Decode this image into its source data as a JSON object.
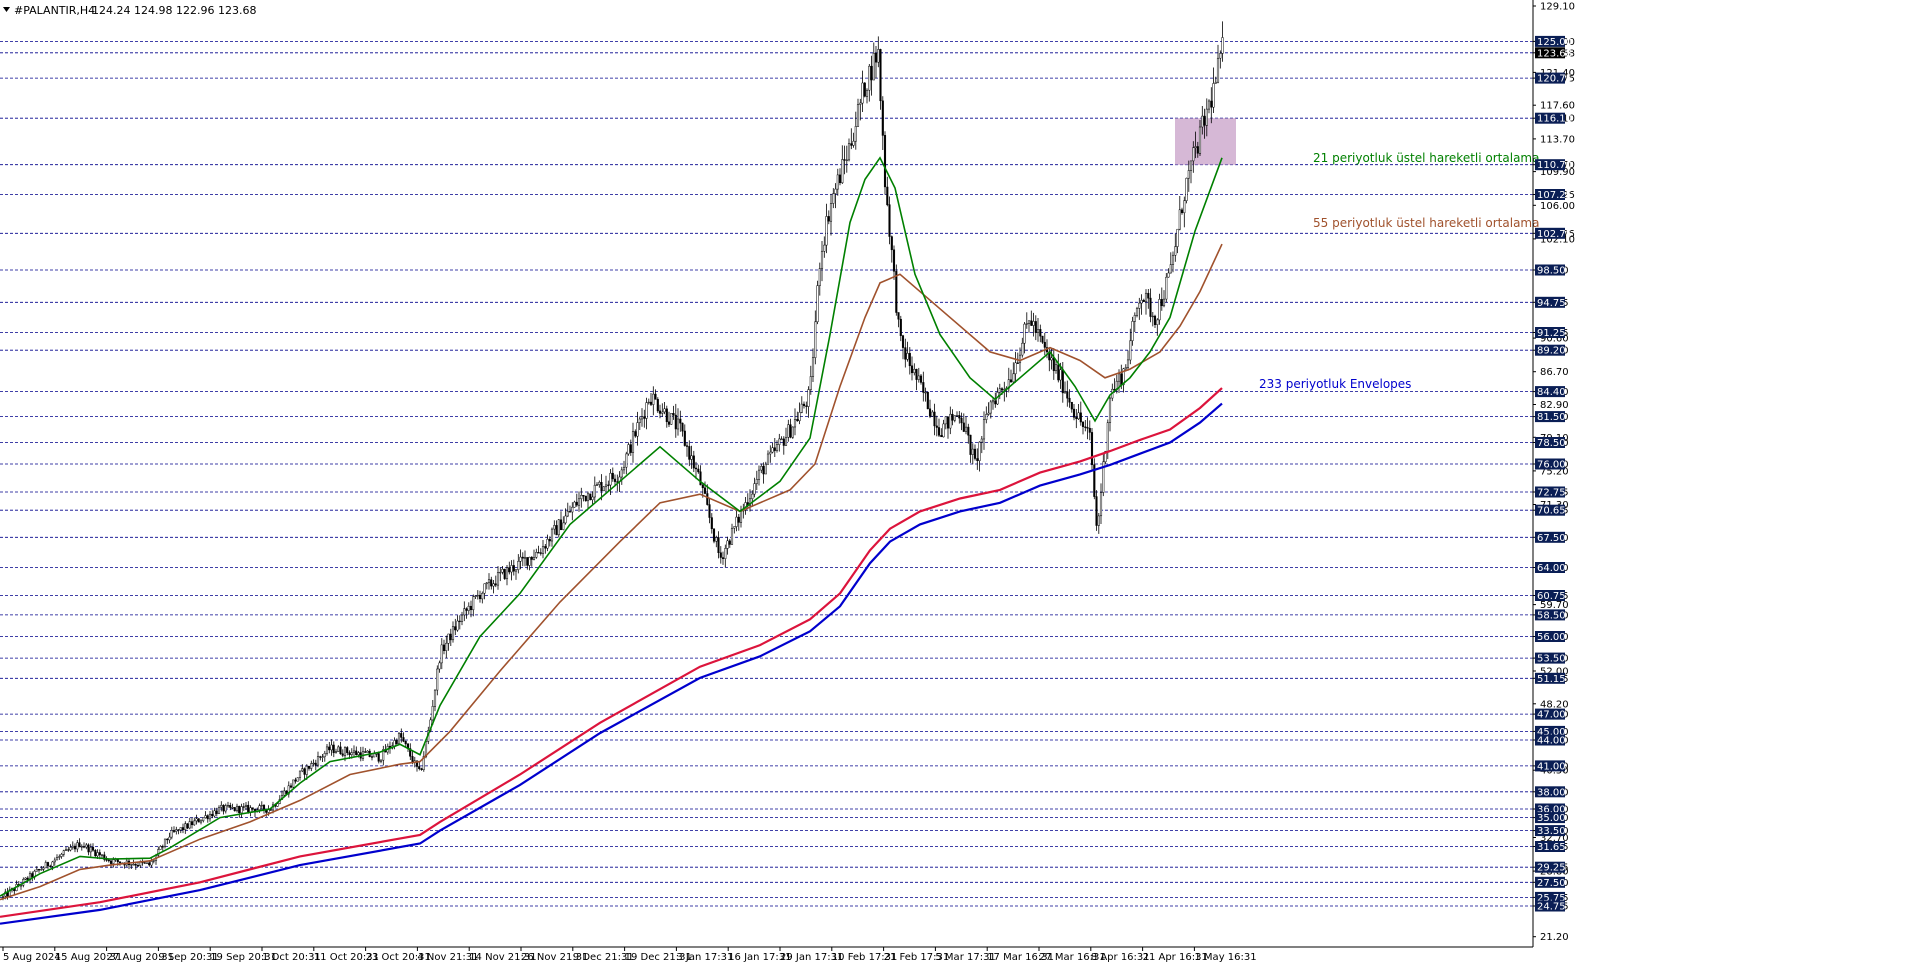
{
  "header": {
    "symbol": "#PALANTIR,H4",
    "ohlc": "124.24 124.98 122.96 123.68"
  },
  "chart_data": {
    "type": "candlestick",
    "y_range": [
      20.0,
      129.8
    ],
    "y_ticks": [
      "129.10",
      "125.00",
      "123.68",
      "121.40",
      "120.75",
      "117.60",
      "116.10",
      "113.70",
      "110.70",
      "109.90",
      "107.25",
      "106.00",
      "102.75",
      "102.10",
      "98.50",
      "94.75",
      "91.25",
      "90.60",
      "89.20",
      "86.70",
      "84.40",
      "82.90",
      "81.50",
      "79.10",
      "78.50",
      "76.00",
      "75.20",
      "72.75",
      "71.30",
      "70.65",
      "67.50",
      "64.00",
      "60.75",
      "59.70",
      "58.50",
      "56.00",
      "53.50",
      "52.00",
      "51.15",
      "48.20",
      "47.00",
      "45.00",
      "44.00",
      "41.00",
      "40.50",
      "38.00",
      "36.00",
      "35.00",
      "33.50",
      "32.70",
      "31.65",
      "29.25",
      "28.80",
      "27.50",
      "25.75",
      "24.75",
      "21.20"
    ],
    "levels": [
      "125.00",
      "123.68",
      "120.75",
      "116.10",
      "110.70",
      "107.25",
      "102.75",
      "98.50",
      "94.75",
      "91.25",
      "89.20",
      "84.40",
      "81.50",
      "78.50",
      "76.00",
      "72.75",
      "70.65",
      "67.50",
      "64.00",
      "60.75",
      "58.50",
      "56.00",
      "53.50",
      "51.15",
      "47.00",
      "45.00",
      "44.00",
      "41.00",
      "38.00",
      "36.00",
      "35.00",
      "33.50",
      "31.65",
      "29.25",
      "27.50",
      "25.75",
      "24.75"
    ],
    "current_price": "123.68",
    "x_labels": [
      "5 Aug 2024",
      "15 Aug 20:31",
      "27 Aug 20:31",
      "9 Sep 20:31",
      "19 Sep 20:31",
      "1 Oct 20:31",
      "11 Oct 20:31",
      "23 Oct 20:31",
      "4 Nov 21:31",
      "14 Nov 21:31",
      "26 Nov 21:31",
      "9 Dec 21:31",
      "19 Dec 21:31",
      "3 Jan 17:31",
      "16 Jan 17:31",
      "29 Jan 17:31",
      "10 Feb 17:31",
      "21 Feb 17:31",
      "5 Mar 17:31",
      "17 Mar 16:31",
      "27 Mar 16:31",
      "8 Apr 16:31",
      "21 Apr 16:31",
      "1 May 16:31"
    ],
    "price_path": [
      [
        0,
        25.5
      ],
      [
        40,
        29
      ],
      [
        80,
        32
      ],
      [
        110,
        30
      ],
      [
        150,
        29.5
      ],
      [
        170,
        33
      ],
      [
        220,
        36
      ],
      [
        270,
        36
      ],
      [
        300,
        40
      ],
      [
        330,
        43
      ],
      [
        380,
        42
      ],
      [
        400,
        44.5
      ],
      [
        420,
        40
      ],
      [
        430,
        46
      ],
      [
        440,
        54
      ],
      [
        460,
        58
      ],
      [
        480,
        61
      ],
      [
        500,
        63
      ],
      [
        540,
        66
      ],
      [
        580,
        72
      ],
      [
        620,
        75
      ],
      [
        650,
        84
      ],
      [
        680,
        80
      ],
      [
        700,
        74
      ],
      [
        720,
        65
      ],
      [
        740,
        70
      ],
      [
        760,
        75
      ],
      [
        790,
        80
      ],
      [
        810,
        84
      ],
      [
        820,
        100
      ],
      [
        830,
        106
      ],
      [
        850,
        113
      ],
      [
        865,
        120
      ],
      [
        878,
        124
      ],
      [
        885,
        109
      ],
      [
        900,
        90
      ],
      [
        920,
        85
      ],
      [
        940,
        80
      ],
      [
        960,
        82
      ],
      [
        975,
        76
      ],
      [
        990,
        83
      ],
      [
        1010,
        86
      ],
      [
        1030,
        93
      ],
      [
        1045,
        89
      ],
      [
        1060,
        86
      ],
      [
        1075,
        82
      ],
      [
        1090,
        79
      ],
      [
        1097,
        68
      ],
      [
        1110,
        84
      ],
      [
        1125,
        87
      ],
      [
        1140,
        96
      ],
      [
        1155,
        93
      ],
      [
        1170,
        98
      ],
      [
        1185,
        108
      ],
      [
        1200,
        114
      ],
      [
        1215,
        120
      ],
      [
        1222,
        124
      ]
    ],
    "ema21": [
      [
        0,
        25.9
      ],
      [
        40,
        28.5
      ],
      [
        80,
        30.5
      ],
      [
        110,
        30.2
      ],
      [
        150,
        30.3
      ],
      [
        170,
        31.5
      ],
      [
        220,
        35
      ],
      [
        270,
        36
      ],
      [
        300,
        39
      ],
      [
        330,
        41.5
      ],
      [
        380,
        42.6
      ],
      [
        400,
        43.5
      ],
      [
        420,
        42.3
      ],
      [
        440,
        48
      ],
      [
        480,
        56
      ],
      [
        520,
        61
      ],
      [
        570,
        69
      ],
      [
        620,
        74
      ],
      [
        660,
        78
      ],
      [
        700,
        74
      ],
      [
        740,
        70.5
      ],
      [
        780,
        74
      ],
      [
        810,
        79
      ],
      [
        830,
        91
      ],
      [
        850,
        104
      ],
      [
        865,
        109
      ],
      [
        880,
        111.5
      ],
      [
        895,
        108
      ],
      [
        915,
        98
      ],
      [
        940,
        91
      ],
      [
        970,
        86
      ],
      [
        995,
        83.5
      ],
      [
        1020,
        86
      ],
      [
        1050,
        89
      ],
      [
        1075,
        85
      ],
      [
        1095,
        81
      ],
      [
        1110,
        84
      ],
      [
        1130,
        86
      ],
      [
        1150,
        89
      ],
      [
        1170,
        93
      ],
      [
        1195,
        103
      ],
      [
        1222,
        111.5
      ]
    ],
    "ema55": [
      [
        0,
        25.5
      ],
      [
        40,
        27
      ],
      [
        80,
        29
      ],
      [
        110,
        29.5
      ],
      [
        150,
        30
      ],
      [
        200,
        32.5
      ],
      [
        250,
        34.5
      ],
      [
        300,
        37
      ],
      [
        350,
        40
      ],
      [
        400,
        41.2
      ],
      [
        420,
        41.5
      ],
      [
        450,
        45
      ],
      [
        500,
        52
      ],
      [
        560,
        60
      ],
      [
        620,
        67
      ],
      [
        660,
        71.5
      ],
      [
        700,
        72.5
      ],
      [
        740,
        70.5
      ],
      [
        790,
        73
      ],
      [
        815,
        76
      ],
      [
        840,
        85
      ],
      [
        865,
        93
      ],
      [
        880,
        97
      ],
      [
        900,
        98
      ],
      [
        940,
        94
      ],
      [
        990,
        89
      ],
      [
        1020,
        88
      ],
      [
        1050,
        89.5
      ],
      [
        1080,
        88
      ],
      [
        1105,
        86
      ],
      [
        1130,
        87
      ],
      [
        1160,
        89
      ],
      [
        1180,
        92
      ],
      [
        1200,
        96
      ],
      [
        1222,
        101.5
      ]
    ],
    "envelope_upper": [
      [
        0,
        23.5
      ],
      [
        100,
        25.2
      ],
      [
        200,
        27.5
      ],
      [
        300,
        30.5
      ],
      [
        420,
        33
      ],
      [
        440,
        34.5
      ],
      [
        520,
        40
      ],
      [
        600,
        46
      ],
      [
        700,
        52.5
      ],
      [
        760,
        55
      ],
      [
        810,
        58
      ],
      [
        840,
        61
      ],
      [
        870,
        66
      ],
      [
        890,
        68.5
      ],
      [
        920,
        70.5
      ],
      [
        960,
        72
      ],
      [
        1000,
        73
      ],
      [
        1040,
        75
      ],
      [
        1080,
        76.3
      ],
      [
        1110,
        77.5
      ],
      [
        1140,
        78.8
      ],
      [
        1170,
        80
      ],
      [
        1200,
        82.5
      ],
      [
        1222,
        84.8
      ]
    ],
    "envelope_lower": [
      [
        0,
        22.7
      ],
      [
        100,
        24.3
      ],
      [
        200,
        26.6
      ],
      [
        300,
        29.5
      ],
      [
        420,
        32
      ],
      [
        440,
        33.5
      ],
      [
        520,
        38.8
      ],
      [
        600,
        44.8
      ],
      [
        700,
        51.2
      ],
      [
        760,
        53.7
      ],
      [
        810,
        56.6
      ],
      [
        840,
        59.5
      ],
      [
        870,
        64.5
      ],
      [
        890,
        67
      ],
      [
        920,
        69
      ],
      [
        960,
        70.5
      ],
      [
        1000,
        71.5
      ],
      [
        1040,
        73.5
      ],
      [
        1080,
        74.8
      ],
      [
        1110,
        75.9
      ],
      [
        1140,
        77.2
      ],
      [
        1170,
        78.5
      ],
      [
        1200,
        80.8
      ],
      [
        1222,
        83
      ]
    ],
    "zone": {
      "from": 1175,
      "to": 1236,
      "y_top": "116.10",
      "y_bottom": "110.70"
    },
    "annotations": [
      {
        "text": "21 periyotluk üstel hareketli ortalama",
        "color": "#008000"
      },
      {
        "text": "55 periyotluk üstel hareketli ortalama",
        "color": "#a0522d"
      },
      {
        "text": "233 periyotluk Envelopes",
        "color": "#0000cd"
      }
    ],
    "colors": {
      "ema21": "#008000",
      "ema55": "#a0522d",
      "envelope_upper": "#dc143c",
      "envelope_lower": "#0000cd",
      "level_line": "#00008b",
      "level_label_bg": "#0a1e55",
      "current_label_bg": "#000000",
      "zone": "#c8a0c8",
      "candles": "#000000"
    },
    "grid": false,
    "legend": "none"
  }
}
